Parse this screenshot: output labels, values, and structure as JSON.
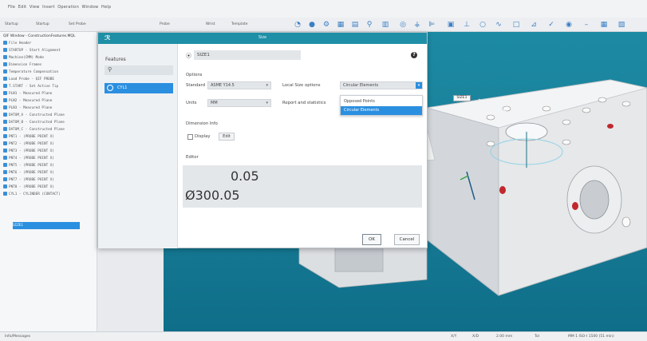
{
  "app": {
    "menu": [
      "File",
      "Edit",
      "View",
      "Insert",
      "Operation",
      "Window",
      "Help"
    ],
    "toolbar_labels": [
      "Startup",
      "Startup",
      "Set Probe",
      "Probe",
      "Wrist",
      "Template"
    ]
  },
  "tree": {
    "title": "QIF Window - ConstructionFeatures.MQL",
    "items": [
      "File Header",
      "STARTUP - Start Alignment",
      "Machine(CMM) Mode",
      "Dimension Frames",
      "Temperature Compensation",
      "Load Probe - QIF PROBE",
      "T.START - Set Active Tip",
      "PLN1 - Measured Plane",
      "PLN2 - Measured Plane",
      "PLN3 - Measured Plane",
      "DATUM_A - Constructed Plane",
      "DATUM_B - Constructed Plane",
      "DATUM_C - Constructed Plane",
      "PNT1 - (PROBE POINT X)",
      "PNT2 - (PROBE POINT X)",
      "PNT3 - (PROBE POINT X)",
      "PNT4 - (PROBE POINT X)",
      "PNT5 - (PROBE POINT X)",
      "PNT6 - (PROBE POINT X)",
      "PNT7 - (PROBE POINT X)",
      "PNT8 - (PROBE POINT X)",
      "CYL1 - CYLINDER (CONTACT)"
    ],
    "selected": "SIZE1"
  },
  "dialog": {
    "title": "Size",
    "features_header": "Features",
    "search_icon": "search-icon",
    "feature_item": "CYL1",
    "name_value": "SIZE1",
    "options_header": "Options",
    "standard_label": "Standard",
    "standard_value": "ASME Y14.5",
    "units_label": "Units",
    "units_value": "MM",
    "local_size_label": "Local Size options",
    "local_size_value": "Circular Elements",
    "report_label": "Report and statistics",
    "dropdown_options": [
      "Opposed Points",
      "Circular Elements"
    ],
    "dim_info_header": "Dimension Info",
    "display_label": "Display",
    "edit_label": "Edit",
    "editor_header": "Editor",
    "editor_line1": "0.05",
    "editor_line2": "Ø300.05",
    "ok": "OK",
    "cancel": "Cancel"
  },
  "viewport": {
    "callout": "SIZE1"
  },
  "statusbar": {
    "left": "Info/Messages",
    "right": [
      "X/Y",
      "X/D",
      "2.00 mm",
      "Tol",
      "MM 1 ISO-I 1500 (51 min)"
    ]
  },
  "colors": {
    "dialog_title": "#1e8fa6",
    "selection": "#2b8fe0",
    "viewport": "#177c96"
  }
}
